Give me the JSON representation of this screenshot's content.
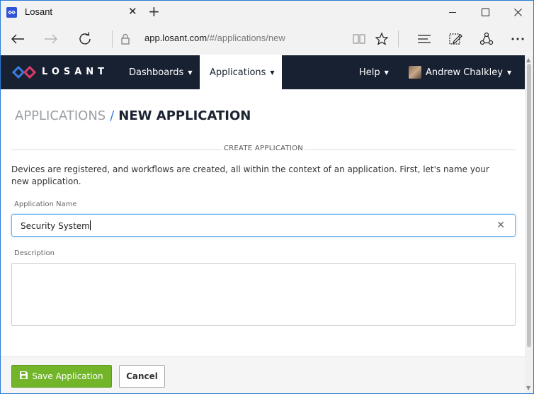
{
  "browser": {
    "tab_title": "Losant",
    "url_host": "app.losant.com",
    "url_path": "/#/applications/new"
  },
  "nav": {
    "logo_text": "LOSANT",
    "items": [
      {
        "label": "Dashboards"
      },
      {
        "label": "Applications"
      },
      {
        "label": "Help"
      }
    ],
    "user_name": "Andrew Chalkley"
  },
  "page": {
    "breadcrumb_parent": "APPLICATIONS",
    "breadcrumb_separator": "/",
    "breadcrumb_current": "NEW APPLICATION",
    "section_title": "CREATE APPLICATION",
    "intro": "Devices are registered, and workflows are created, all within the context of an application. First, let's name your new application."
  },
  "form": {
    "name_label": "Application Name",
    "name_value": "Security System",
    "description_label": "Description",
    "description_value": ""
  },
  "buttons": {
    "save_label": "Save Application",
    "cancel_label": "Cancel"
  },
  "colors": {
    "nav_bg": "#182132",
    "accent_blue": "#3a7de0",
    "save_green": "#73b52a",
    "focus_border": "#66afe9"
  },
  "icons": {
    "favicon": "losant-logo-icon",
    "save": "floppy-disk-icon",
    "clear": "close-icon"
  }
}
